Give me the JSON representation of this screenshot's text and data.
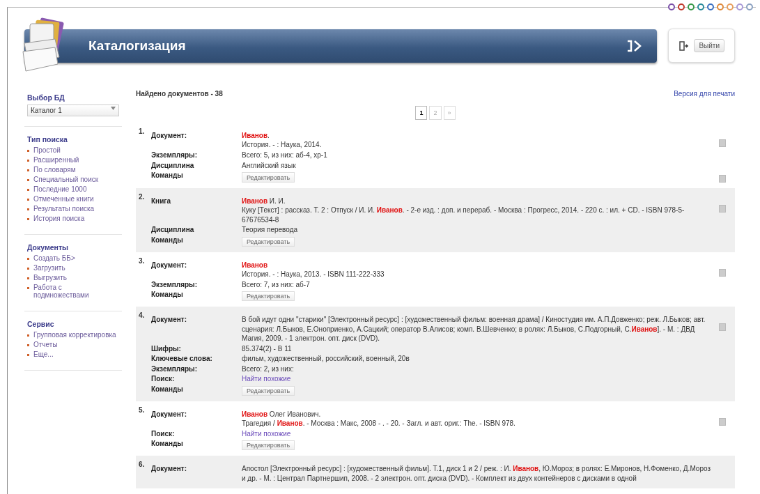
{
  "theme_swatches": [
    {
      "color": "#7a4fa8"
    },
    {
      "color": "#c0392b"
    },
    {
      "color": "#3a9a4a"
    },
    {
      "color": "#2a8a9a"
    },
    {
      "color": "#3a6fc0"
    },
    {
      "color": "#e08a3a"
    },
    {
      "color": "#e8a060"
    },
    {
      "color": "#a89ad8"
    },
    {
      "color": "#8aa0c0"
    }
  ],
  "header": {
    "title": "Каталогизация",
    "logout": "Выйти"
  },
  "sidebar": {
    "db_heading": "Выбор БД",
    "db_select": "Каталог 1",
    "sections": [
      {
        "heading": "Тип поиска",
        "items": [
          "Простой",
          "Расширенный",
          "По словарям",
          "Специальный поиск",
          "Последние 1000",
          "Отмеченные книги",
          "Результаты поиска",
          "История поиска"
        ]
      },
      {
        "heading": "Документы",
        "items": [
          "Создать  ББ>",
          "Загрузить",
          "Выгрузить",
          "Работа с подмножествами"
        ]
      },
      {
        "heading": "Сервис",
        "items": [
          "Групповая корректировка",
          "Отчеты",
          "Еще..."
        ]
      }
    ]
  },
  "results": {
    "found": "Найдено документов - 38",
    "print_link": "Версия для печати",
    "pages": [
      {
        "label": "1",
        "selected": true
      },
      {
        "label": "2",
        "selected": false
      },
      {
        "label": "»",
        "selected": false
      }
    ],
    "records": [
      {
        "number": "1.",
        "checkboxes": [
          {
            "checked": false
          },
          {
            "checked": false
          }
        ],
        "fields": [
          {
            "label": "Документ:",
            "kind": "text",
            "lines": [
              "**Иванов**.",
              "История. - : Наука, 2014."
            ]
          },
          {
            "label": "Экземпляры:",
            "kind": "text",
            "lines": [
              "Всего: 5, из них: аб-4, хр-1"
            ]
          },
          {
            "label": "Дисциплина",
            "kind": "text",
            "lines": [
              "Английский язык"
            ]
          },
          {
            "label": "Команды",
            "kind": "button",
            "lines": [
              "Редактировать"
            ]
          }
        ]
      },
      {
        "number": "2.",
        "checkboxes": [
          {
            "checked": false
          }
        ],
        "fields": [
          {
            "label": "Книга",
            "kind": "text",
            "lines": [
              "**Иванов** И. И.",
              "Куку [Текст] : рассказ. Т. 2 : Отпуск / И. И. **Иванов**. - 2-е изд. : доп. и перераб. - Москва : Прогресс, 2014. - 220 с. : ил. + CD. - ISBN 978-5-67676534-8"
            ]
          },
          {
            "label": "Дисциплина",
            "kind": "text",
            "lines": [
              "Теория перевода"
            ]
          },
          {
            "label": "Команды",
            "kind": "button",
            "lines": [
              "Редактировать"
            ]
          }
        ]
      },
      {
        "number": "3.",
        "checkboxes": [
          {
            "checked": false
          }
        ],
        "fields": [
          {
            "label": "Документ:",
            "kind": "text",
            "lines": [
              "**Иванов**",
              "История. - : Наука, 2013. - ISBN 111-222-333"
            ]
          },
          {
            "label": "Экземпляры:",
            "kind": "text",
            "lines": [
              "Всего: 7, из них: аб-7"
            ]
          },
          {
            "label": "Команды",
            "kind": "button",
            "lines": [
              "Редактировать"
            ]
          }
        ]
      },
      {
        "number": "4.",
        "checkboxes": [
          {
            "checked": false
          }
        ],
        "fields": [
          {
            "label": "Документ:",
            "kind": "text",
            "lines": [
              "В бой идут одни \"старики\" [Электронный ресурс] : [художественный фильм: военная драма] / Киностудия им. А.П.Довженко; реж. Л.Быков; авт. сценария: Л.Быков, Е.Оноприенко, А.Сацкий; оператор В.Алисов; комп. В.Шевченко; в ролях: Л.Быков, С.Подгорный, С.**Иванов**]. - М. : ДВД Магия, 2009. - 1 электрон. опт. диск (DVD)."
            ]
          },
          {
            "label": "Шифры:",
            "kind": "text",
            "lines": [
              "85.374(2) - В 11"
            ]
          },
          {
            "label": "Ключевые слова:",
            "kind": "text",
            "lines": [
              "фильм, художественный, российский, военный, 20в"
            ]
          },
          {
            "label": "Экземпляры:",
            "kind": "text",
            "lines": [
              "Всего: 2, из них:"
            ]
          },
          {
            "label": "Поиск:",
            "kind": "link",
            "lines": [
              "Найти похожие"
            ]
          },
          {
            "label": "Команды",
            "kind": "button",
            "lines": [
              "Редактировать"
            ]
          }
        ]
      },
      {
        "number": "5.",
        "checkboxes": [
          {
            "checked": false
          }
        ],
        "fields": [
          {
            "label": "Документ:",
            "kind": "text",
            "lines": [
              "**Иванов** Олег Иванович.",
              "Трагедия / **Иванов**. - Москва : Макс, 2008 - . - 20. - Загл. и авт. ориг.: The. - ISBN 978."
            ]
          },
          {
            "label": "Поиск:",
            "kind": "link",
            "lines": [
              "Найти похожие"
            ]
          },
          {
            "label": "Команды",
            "kind": "button",
            "lines": [
              "Редактировать"
            ]
          }
        ]
      },
      {
        "number": "6.",
        "fields": [
          {
            "label": "Документ:",
            "kind": "text",
            "lines": [
              "Апостол [Электронный ресурс] : [художественный фильм]. Т.1, диск 1 и 2 / реж. : И. **Иванов**, Ю.Мороз; в ролях: Е.Миронов, Н.Фоменко, Д.Мороз и др. - М. : Централ Партнершип, 2008. - 2 электрон. опт. диска (DVD). - Комплект из двух контейнеров с дисками в одной"
            ]
          }
        ]
      }
    ]
  }
}
